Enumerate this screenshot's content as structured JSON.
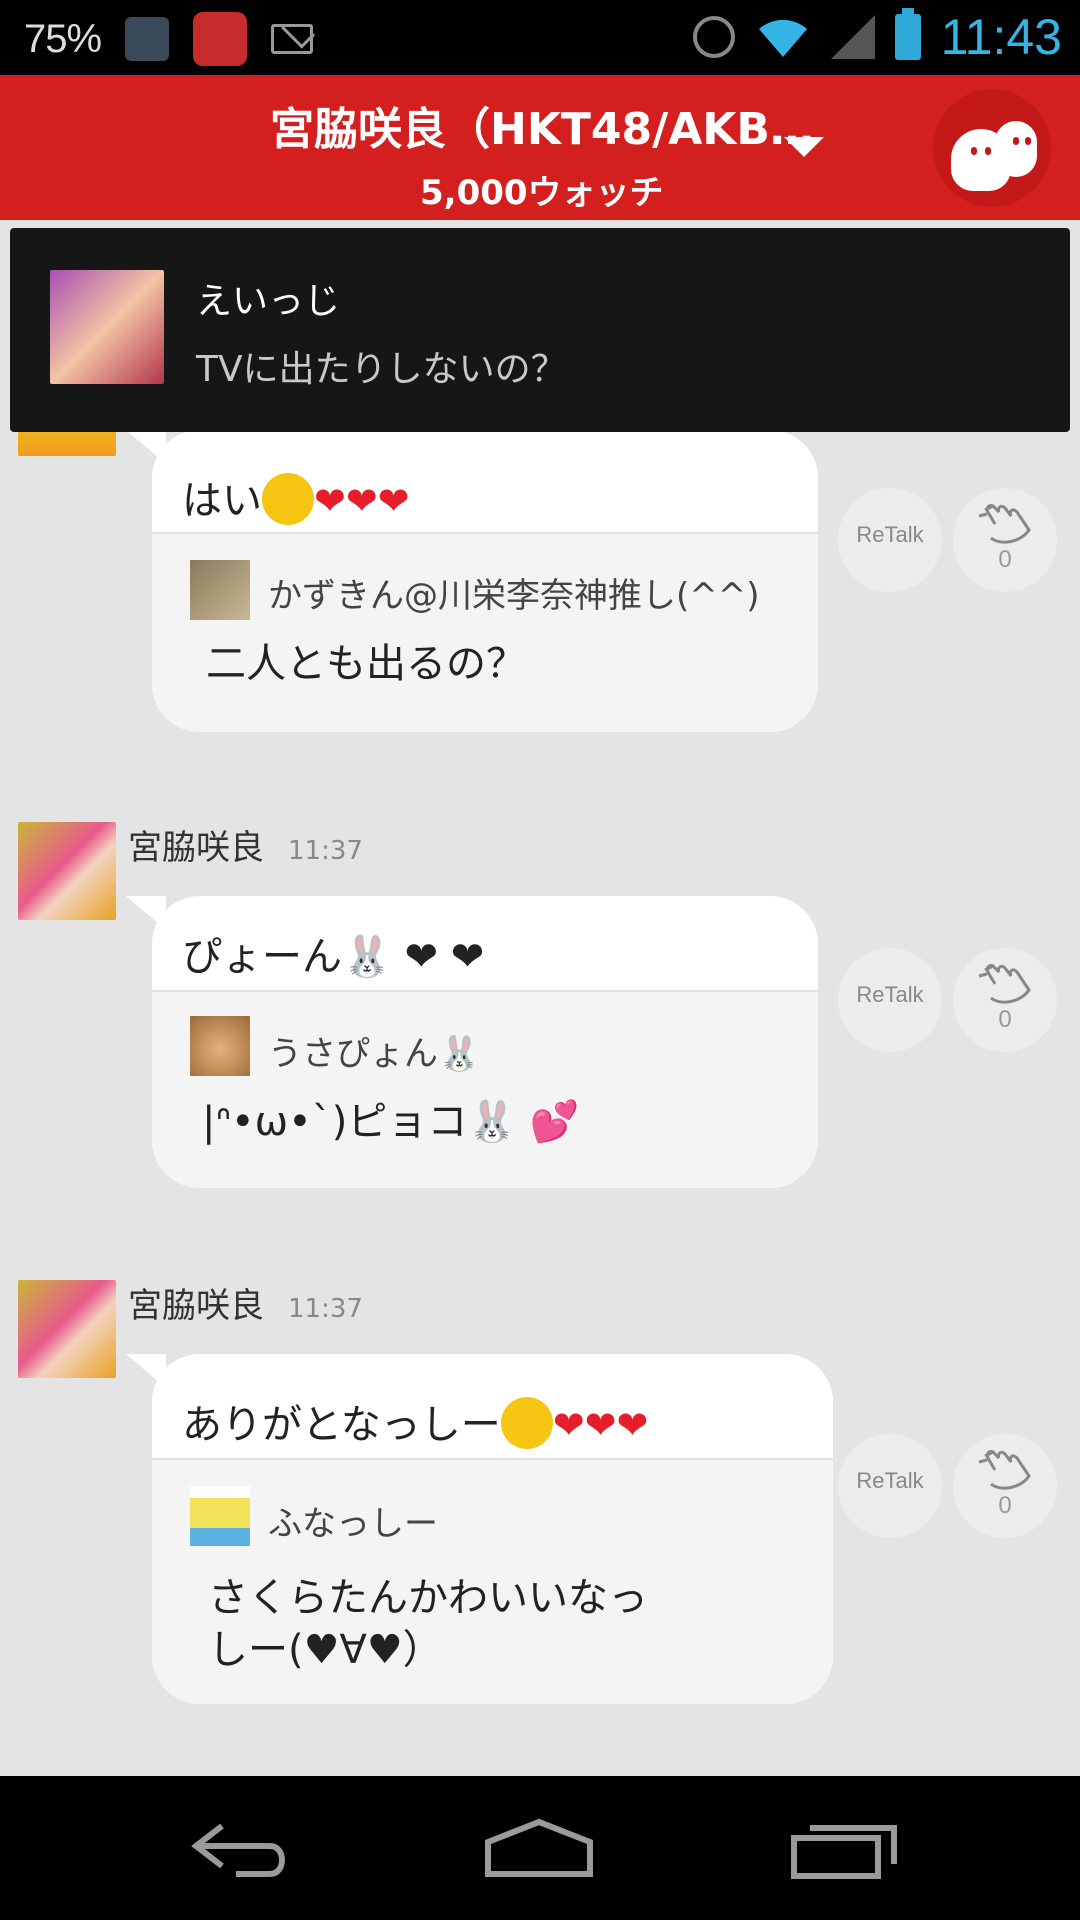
{
  "status_bar": {
    "battery_percent": "75%",
    "time": "11:43"
  },
  "header": {
    "title": "宮脇咲良（HKT48/AKB…",
    "subtitle": "5,000ウォッチ"
  },
  "notification": {
    "name": "えいっじ",
    "message": "TVに出たりしないの？"
  },
  "messages": [
    {
      "reply": "はい",
      "reply_emoji": "smiley-face",
      "reply_hearts": "❤❤❤",
      "quoted_user": "かずきん@川栄李奈神推し(^^)",
      "quoted_text": "二人とも出るの？",
      "retalk_label": "ReTalk",
      "clap_count": "0"
    },
    {
      "sender": "宮脇咲良",
      "time": "11:37",
      "reply": "ぴょーん🐰 ❤ ❤",
      "quoted_user": "うさぴょん🐰",
      "quoted_text": "|ᐢ•ω•`)ピョコ🐰 💕",
      "retalk_label": "ReTalk",
      "clap_count": "0"
    },
    {
      "sender": "宮脇咲良",
      "time": "11:37",
      "reply": "ありがとなっしー",
      "reply_emoji": "laughing-face",
      "reply_hearts": "❤❤❤",
      "quoted_user": "ふなっしー",
      "quoted_text_line1": "さくらたんかわいいなっ",
      "quoted_text_line2": "しー(♥∀♥）",
      "retalk_label": "ReTalk",
      "clap_count": "0"
    }
  ],
  "colors": {
    "header_red": "#d41f1f",
    "background": "#e4e4e4",
    "heart": "#e51e2a",
    "time_blue": "#35b5e5"
  }
}
